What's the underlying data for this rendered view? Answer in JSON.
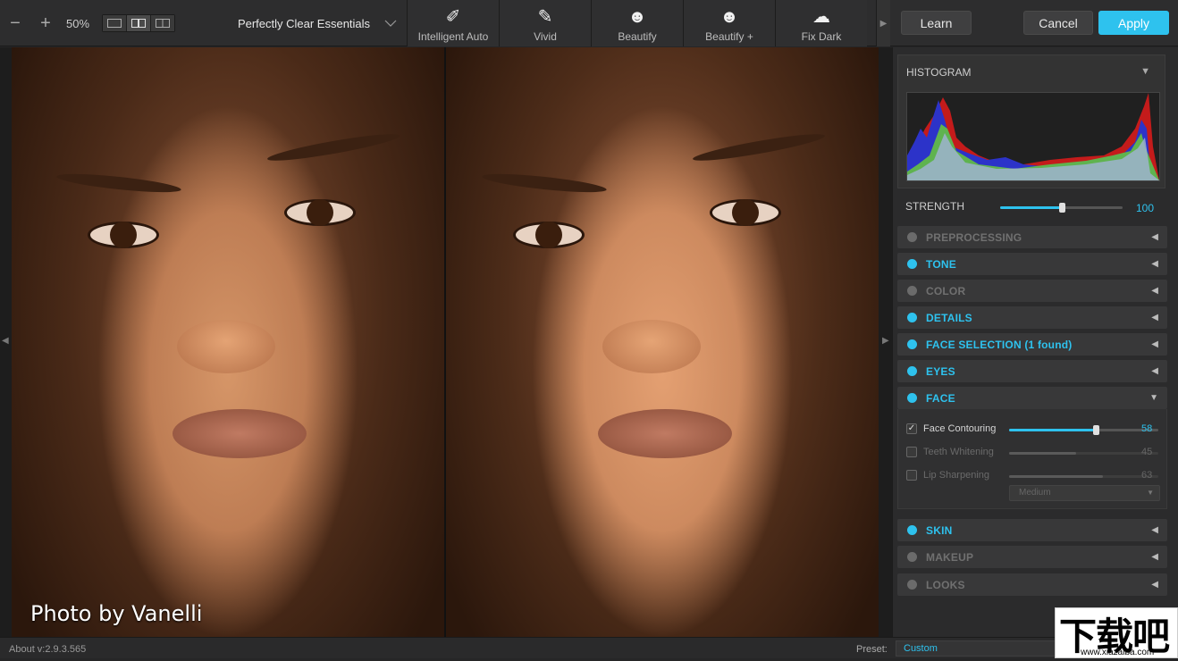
{
  "toolbar": {
    "zoom_out": "−",
    "zoom_in": "+",
    "zoom": "50%",
    "view_modes": [
      "single-view-icon",
      "split-view-icon",
      "side-by-side-icon"
    ],
    "preset_name": "Perfectly Clear Essentials",
    "presets": [
      {
        "label": "Intelligent Auto",
        "icon": "magic-wand-icon",
        "glyph": "✐"
      },
      {
        "label": "Vivid",
        "icon": "brush-icon",
        "glyph": "✎"
      },
      {
        "label": "Beautify",
        "icon": "face-icon",
        "glyph": "☻"
      },
      {
        "label": "Beautify +",
        "icon": "face-plus-icon",
        "glyph": "☻"
      },
      {
        "label": "Fix Dark",
        "icon": "cloud-icon",
        "glyph": "☁"
      }
    ],
    "learn": "Learn",
    "cancel": "Cancel",
    "apply": "Apply"
  },
  "photo": {
    "credit": "Photo by Vanelli"
  },
  "panel": {
    "histogram_title": "HISTOGRAM",
    "strength_label": "STRENGTH",
    "strength_value": "100",
    "strength_fraction": 0.5,
    "sections_top": [
      {
        "name": "PREPROCESSING",
        "on": false
      },
      {
        "name": "TONE",
        "on": true
      },
      {
        "name": "COLOR",
        "on": false
      },
      {
        "name": "DETAILS",
        "on": true
      },
      {
        "name": "FACE SELECTION (1 found)",
        "on": true
      },
      {
        "name": "EYES",
        "on": true
      },
      {
        "name": "FACE",
        "on": true
      }
    ],
    "face": {
      "contouring": {
        "label": "Face Contouring",
        "value": "58",
        "fraction": 0.58,
        "checked": true
      },
      "teeth": {
        "label": "Teeth Whitening",
        "value": "45",
        "fraction": 0.45,
        "checked": false
      },
      "lip": {
        "label": "Lip Sharpening",
        "value": "63",
        "fraction": 0.63,
        "checked": false
      },
      "dropdown": "Medium"
    },
    "sections_bottom": [
      {
        "name": "SKIN",
        "on": true
      },
      {
        "name": "MAKEUP",
        "on": false
      },
      {
        "name": "LOOKS",
        "on": false
      }
    ],
    "accent": "#2ec2ee"
  },
  "status": {
    "about": "About v:2.9.3.565",
    "preset_label": "Preset:",
    "preset_value": "Custom"
  },
  "watermark": {
    "text_cn": "下载吧",
    "url": "www.xiazaiba.com"
  }
}
